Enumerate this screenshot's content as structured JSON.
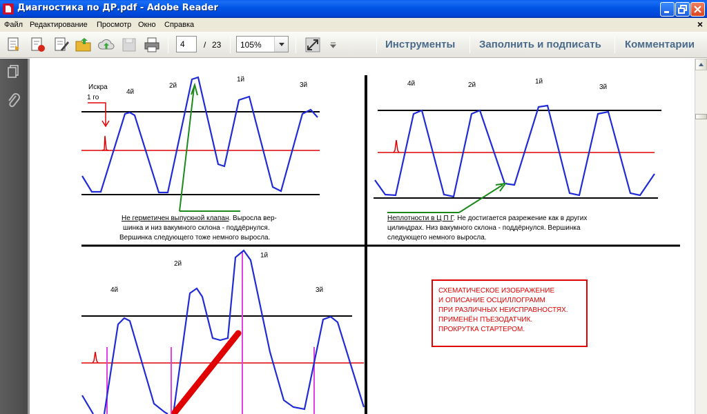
{
  "window": {
    "title": "Диагностика по ДР.pdf - Adobe Reader"
  },
  "menu": {
    "items": [
      "Файл",
      "Редактирование",
      "Просмотр",
      "Окно",
      "Справка"
    ],
    "doc_close": "×"
  },
  "toolbar": {
    "page_current": "4",
    "page_sep": "/",
    "page_total": "23",
    "zoom": "105%",
    "tools": "Инструменты",
    "fill_sign": "Заполнить и подписать",
    "comments": "Комментарии"
  },
  "doc": {
    "tl": {
      "spark_label_1": "Искра",
      "spark_label_2": "1 го",
      "c4": "4й",
      "c2": "2й",
      "c1": "1й",
      "c3": "3й",
      "desc_u": "Не герметичен выпускной клапан",
      "desc_1_rest": ". Выросла вер-",
      "desc_2": "шинка и низ вакумного склона - поддёрнулся.",
      "desc_3": "Вершинка следующего тоже немного выросла."
    },
    "tr": {
      "c4": "4й",
      "c2": "2й",
      "c1": "1й",
      "c3": "3й",
      "desc_u": "Неплотности в Ц П Г",
      "desc_1_rest": ". Не достигается разрежение как в других",
      "desc_2": "цилиндрах. Низ вакумного склона - поддёрнулся. Вершинка",
      "desc_3": "следующего немного выросла."
    },
    "bl": {
      "c4": "4й",
      "c2": "2й",
      "c1": "1й",
      "c3": "3й"
    },
    "box": {
      "line1": "СХЕМАТИЧЕСКОЕ ИЗОБРАЖЕНИЕ",
      "line2": "И ОПИСАНИЕ ОСЦИЛЛОГРАММ",
      "line3": "ПРИ РАЗЛИЧНЫХ НЕИСПРАВНОСТЯХ.",
      "line4": "ПРИМЕНЁН ПЪЕЗОДАТЧИК.",
      "line5": "ПРОКРУТКА СТАРТЕРОМ."
    }
  },
  "colors": {
    "trace": "#1f2bd6",
    "baseline": "#e00000",
    "arrow": "#1a8a1a",
    "marker": "#e040e0"
  }
}
